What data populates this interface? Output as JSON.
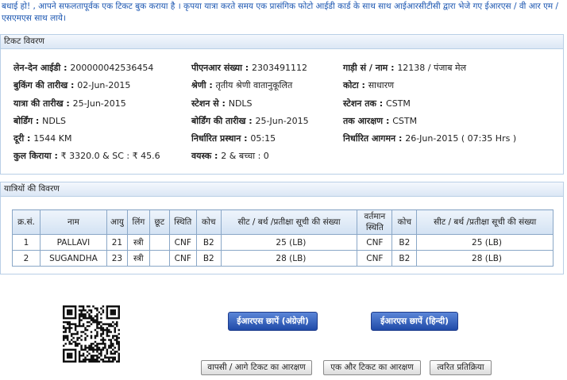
{
  "message": "बधाई हो! , आपने सफलतापूर्वक एक टिकट बुक कराया है । कृपया यात्रा करते समय एक प्रासंगिक फोटो आईडी कार्ड के साथ साथ आईआरसीटीसी द्वारा भेजे गए ईआरएस / वी आर एम / एसएमएस साथ लाये।",
  "ticket": {
    "section_title": "टिकट विवरण",
    "fields": [
      {
        "label": "लेन-देन आईडी : ",
        "value": "200000042536454"
      },
      {
        "label": "पीएनआर संख्या : ",
        "value": "2303491112"
      },
      {
        "label": "गाड़ी सं / नाम : ",
        "value": "12138 / पंजाब मेल"
      },
      {
        "label": "बुकिंग की तारीख : ",
        "value": "02-Jun-2015"
      },
      {
        "label": "श्रेणी : ",
        "value": "तृतीय श्रेणी वातानुकूलित"
      },
      {
        "label": "कोटा : ",
        "value": "साधारण"
      },
      {
        "label": "यात्रा की तारीख : ",
        "value": "25-Jun-2015"
      },
      {
        "label": "स्टेशन से : ",
        "value": "NDLS"
      },
      {
        "label": "स्टेशन तक : ",
        "value": "CSTM"
      },
      {
        "label": "बोर्डिंग : ",
        "value": "NDLS"
      },
      {
        "label": "बोर्डिंग की तारीख : ",
        "value": "25-Jun-2015"
      },
      {
        "label": "तक आरक्षण : ",
        "value": "CSTM"
      },
      {
        "label": "दूरी : ",
        "value": "1544 KM"
      },
      {
        "label": "निर्धारित प्रस्थान : ",
        "value": "05:15"
      },
      {
        "label": "निर्धारित आगमन : ",
        "value": "26-Jun-2015 ( 07:35 Hrs )"
      },
      {
        "label": "कुल किराया : ",
        "value": "₹ 3320.0 & SC : ₹ 45.6"
      },
      {
        "label": "वयस्क : ",
        "value": "2 & बच्चा : 0"
      }
    ]
  },
  "passengers": {
    "section_title": "यात्रियों की विवरण",
    "headers": [
      "क्र.सं.",
      "नाम",
      "आयु",
      "लिंग",
      "छूट",
      "स्थिति",
      "कोच",
      "सीट / बर्थ /प्रतीक्षा सूची की संख्या",
      "वर्तमान स्थिति",
      "कोच",
      "सीट / बर्थ /प्रतीक्षा सूची की संख्या"
    ],
    "rows": [
      [
        "1",
        "PALLAVI",
        "21",
        "स्त्री",
        "",
        "CNF",
        "B2",
        "25 (LB)",
        "CNF",
        "B2",
        "25 (LB)"
      ],
      [
        "2",
        "SUGANDHA",
        "23",
        "स्त्री",
        "",
        "CNF",
        "B2",
        "28 (LB)",
        "CNF",
        "B2",
        "28 (LB)"
      ]
    ]
  },
  "buttons": {
    "print_english": "ईआरएस छापें (अंग्रेज़ी)",
    "print_hindi": "ईआरएस छापें (हिन्दी)",
    "return_booking": "वापसी / आगे टिकट का आरक्षण",
    "book_another": "एक और टिकट का आरक्षण",
    "feedback": "त्वरित प्रतिक्रिया"
  }
}
